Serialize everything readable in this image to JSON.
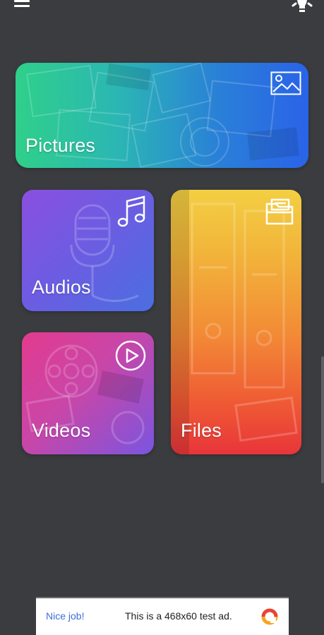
{
  "tiles": {
    "pictures": {
      "label": "Pictures",
      "icon": "image-icon"
    },
    "audios": {
      "label": "Audios",
      "icon": "music-note-icon"
    },
    "videos": {
      "label": "Videos",
      "icon": "play-circle-icon"
    },
    "files": {
      "label": "Files",
      "icon": "folder-icon"
    }
  },
  "ad": {
    "lead": "Nice job!",
    "text": "This is a 468x60 test ad."
  },
  "colors": {
    "background": "#3b3c40",
    "pictures_gradient": [
      "#2fd08a",
      "#2a63e8"
    ],
    "audios_gradient": [
      "#8a4fe0",
      "#4a6fe0"
    ],
    "videos_gradient": [
      "#e23b8e",
      "#7a55e0"
    ],
    "files_gradient": [
      "#f3cf43",
      "#e8353a"
    ],
    "ad_link": "#3c6fd8"
  }
}
